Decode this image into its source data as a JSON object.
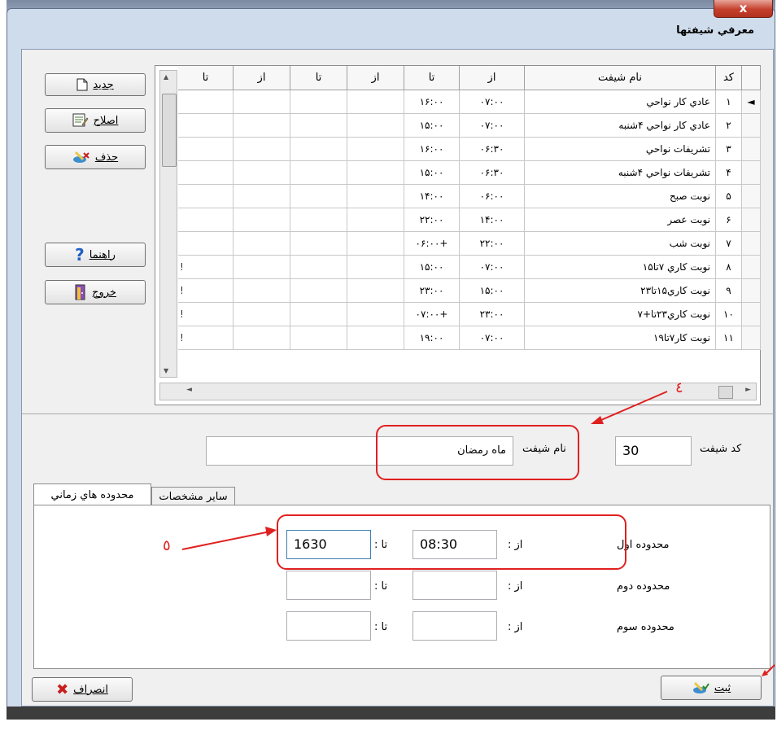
{
  "window": {
    "title": "معرفي شيفتها",
    "close_label": "x"
  },
  "buttons": {
    "new": "جديد",
    "edit": "اصلاح",
    "delete": "حذف",
    "help": "راهنما",
    "exit": "خروج",
    "cancel": "انصراف",
    "save": "ثبت"
  },
  "grid": {
    "columns": [
      "كد",
      "نام شيفت",
      "از",
      "تا",
      "از",
      "تا",
      "از",
      "تا"
    ],
    "rows": [
      {
        "code": "١",
        "name": "عادي كار نواحي",
        "from": "٠٧:٠٠",
        "to": "١۶:٠٠",
        "marker": ""
      },
      {
        "code": "٢",
        "name": "عادي كار نواحي ۴شنبه",
        "from": "٠٧:٠٠",
        "to": "١۵:٠٠",
        "marker": ""
      },
      {
        "code": "٣",
        "name": "تشريفات نواحي",
        "from": "٠۶:٣٠",
        "to": "١۶:٠٠",
        "marker": ""
      },
      {
        "code": "۴",
        "name": "تشريفات نواحي ۴شنبه",
        "from": "٠۶:٣٠",
        "to": "١۵:٠٠",
        "marker": ""
      },
      {
        "code": "۵",
        "name": "نوبت صبح",
        "from": "٠۶:٠٠",
        "to": "١۴:٠٠",
        "marker": ""
      },
      {
        "code": "۶",
        "name": "نوبت عصر",
        "from": "١۴:٠٠",
        "to": "٢٢:٠٠",
        "marker": ""
      },
      {
        "code": "٧",
        "name": "نوبت شب",
        "from": "٢٢:٠٠",
        "to": "٠۶:٠٠+",
        "marker": ""
      },
      {
        "code": "٨",
        "name": "نوبت كاري ٧تا١۵",
        "from": "٠٧:٠٠",
        "to": "١۵:٠٠",
        "marker": "!"
      },
      {
        "code": "٩",
        "name": "نوبت كاري١۵تا٢٣",
        "from": "١۵:٠٠",
        "to": "٢٣:٠٠",
        "marker": "!"
      },
      {
        "code": "١٠",
        "name": "نوبت كاري٢٣تا+٧",
        "from": "٢٣:٠٠",
        "to": "٠٧:٠٠+",
        "marker": "!"
      },
      {
        "code": "١١",
        "name": "نوبت كار٧تا١٩",
        "from": "٠٧:٠٠",
        "to": "١٩:٠٠",
        "marker": "!"
      }
    ]
  },
  "form": {
    "code_label": "كد شيفت",
    "code_value": "30",
    "name_label": "نام شيفت",
    "name_value": "ماه رمضان"
  },
  "tabs": {
    "time_ranges": "محدوده هاي زماني",
    "other": "ساير مشخصات"
  },
  "ranges": {
    "from_label": "از :",
    "to_label": "تا :",
    "first_label": "محدوده اول",
    "second_label": "محدوده دوم",
    "third_label": "محدوده سوم",
    "first_from": "08:30",
    "first_to": "1630",
    "second_from": "",
    "second_to": "",
    "third_from": "",
    "third_to": ""
  },
  "annotations": {
    "four": "٤",
    "five": "٥"
  },
  "colors": {
    "annotation_red": "#e02020",
    "close_red": "#c4402c"
  }
}
